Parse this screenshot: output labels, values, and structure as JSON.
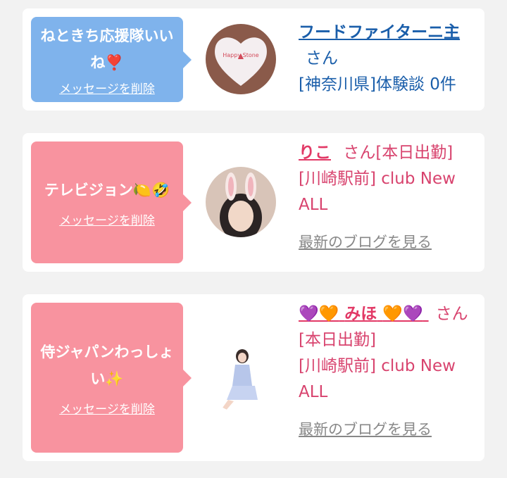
{
  "cards": [
    {
      "message": "ねときち応援隊いいね❣️",
      "delete_label": "メッセージを削除",
      "name": "フードファイターニ主",
      "honorific": "さん",
      "detail": "[神奈川県]体験談 0件",
      "avatar_text": "Happy Stone"
    },
    {
      "message": "テレビジョン🍋🤣",
      "delete_label": "メッセージを削除",
      "name": "りこ",
      "honorific": "さん[本日出勤]",
      "shop": "[川崎駅前] club New ALL",
      "blog_link": "最新のブログを見る"
    },
    {
      "message": "侍ジャパンわっしょい✨",
      "delete_label": "メッセージを削除",
      "name_heart_left": "💜🧡",
      "name": "みほ",
      "name_heart_right": "🧡💜",
      "honorific": "さん[本日出勤]",
      "shop": "[川崎駅前] club New ALL",
      "blog_link": "最新のブログを見る"
    }
  ]
}
